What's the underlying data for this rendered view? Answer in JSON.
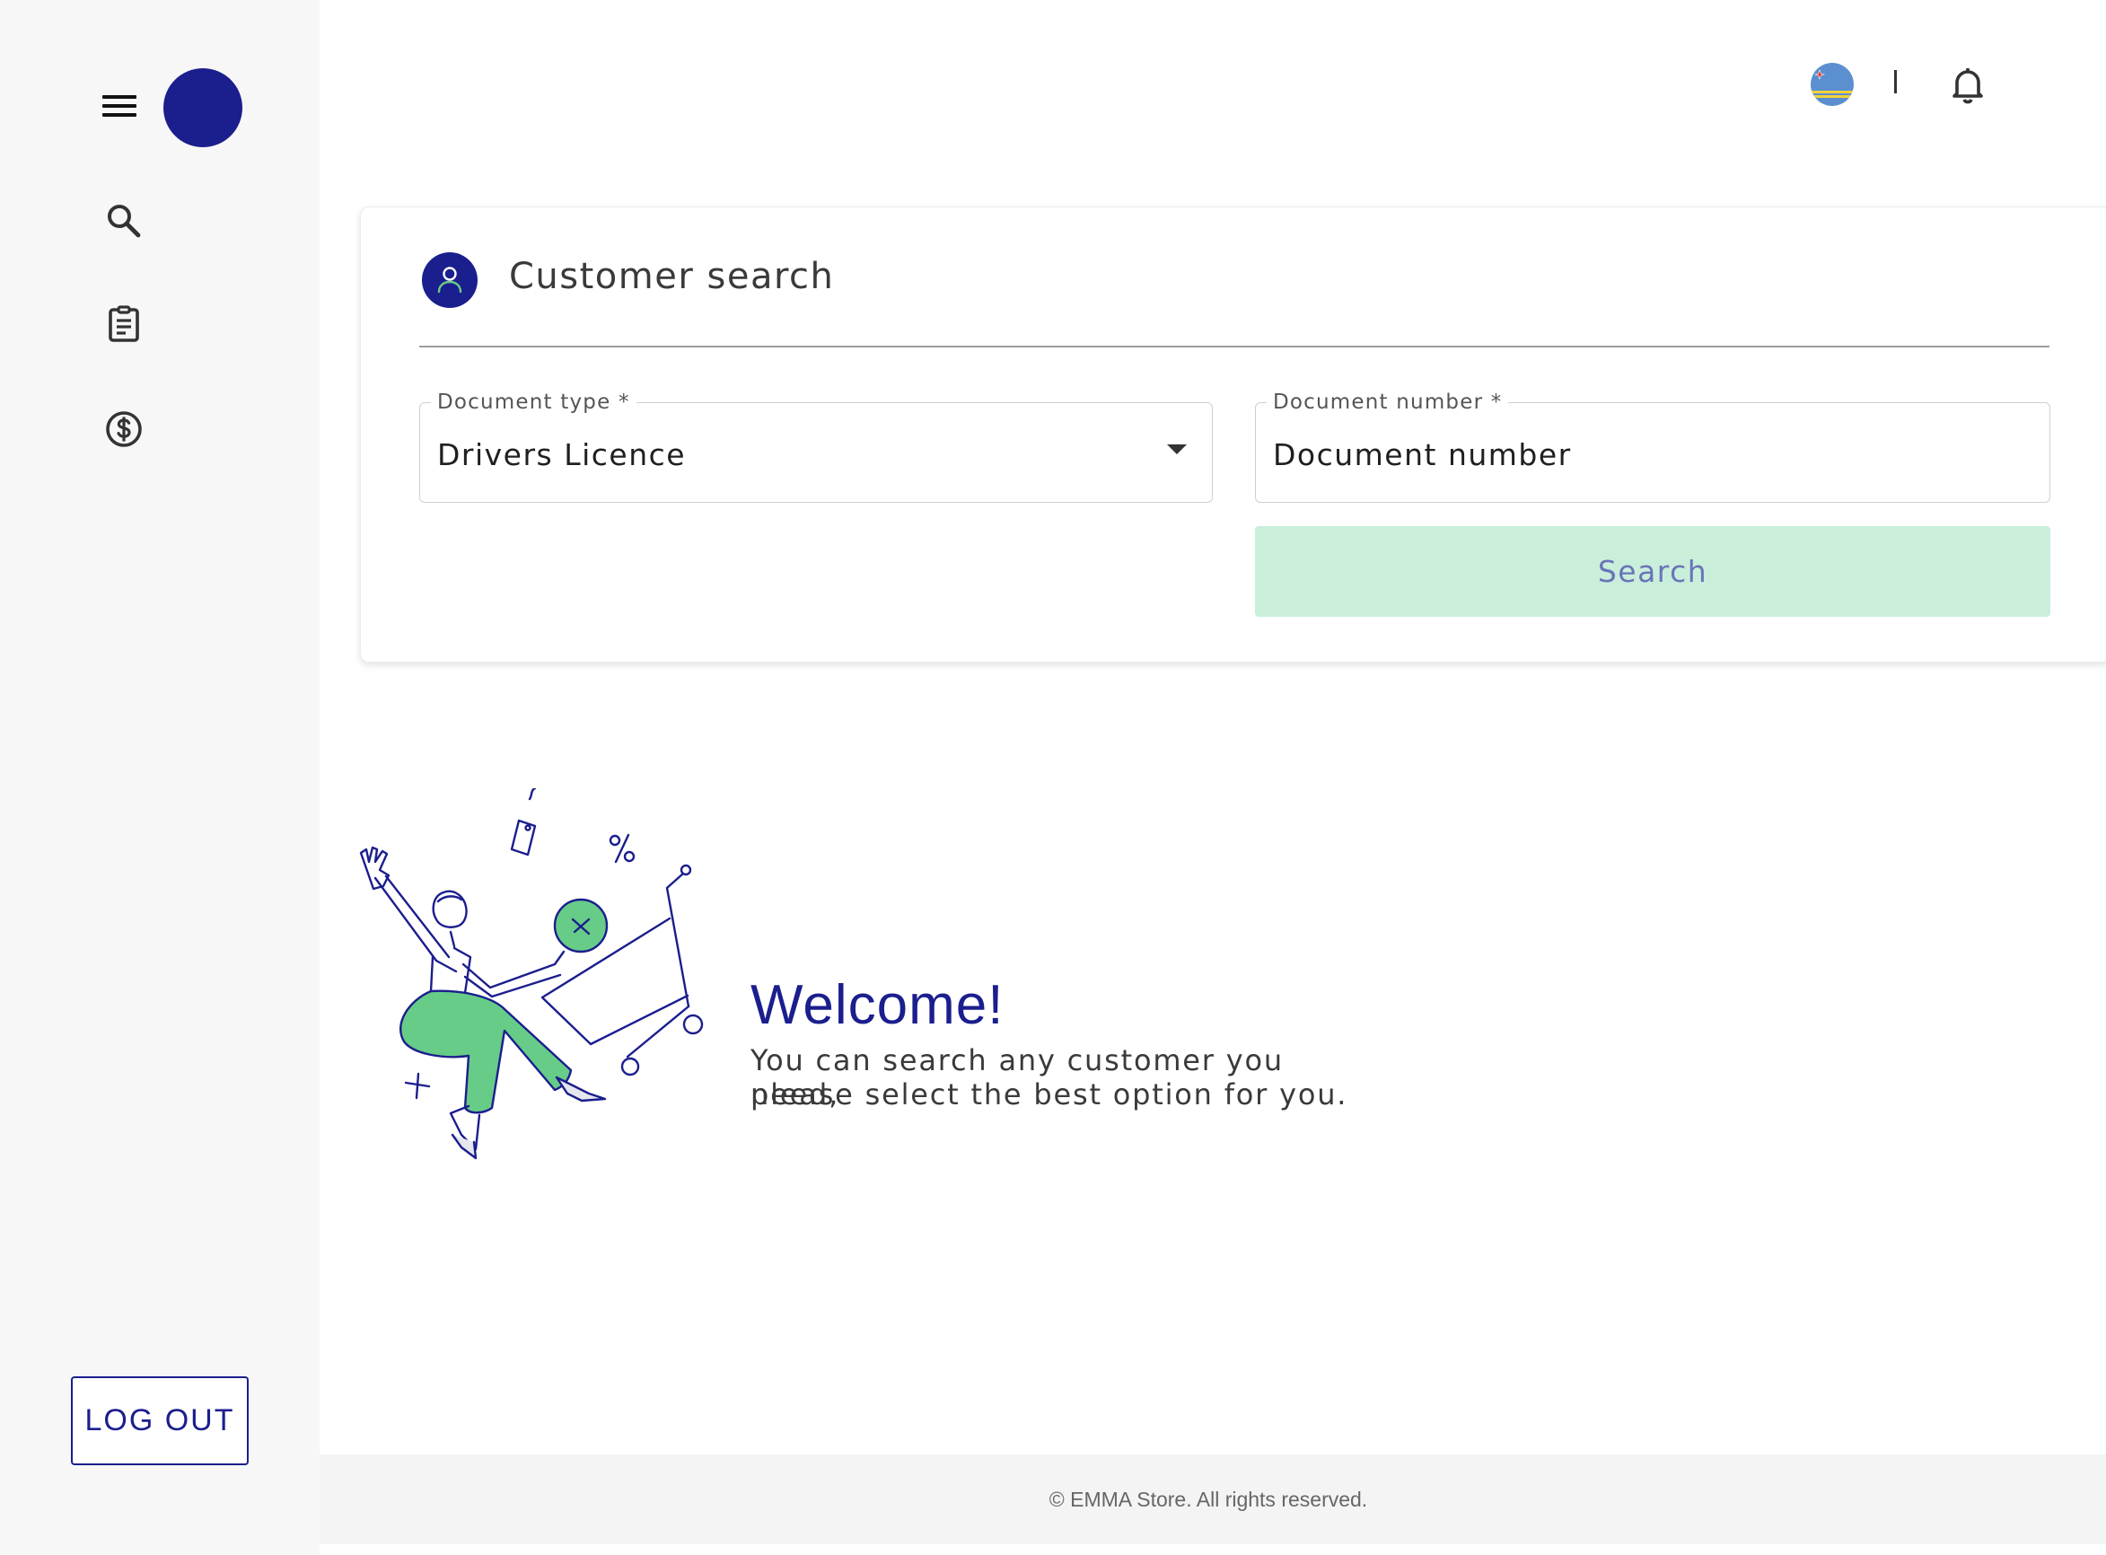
{
  "sidebar": {
    "nav_icons": [
      "search-icon",
      "clipboard-icon",
      "dollar-icon"
    ],
    "logout_label": "LOG OUT"
  },
  "topbar": {
    "separator": "|",
    "flag_icon": "aruba-flag-icon",
    "notification_icon": "bell-icon"
  },
  "customer_search": {
    "title": "Customer search",
    "document_type": {
      "label": "Document type *",
      "value": "Drivers Licence"
    },
    "document_number": {
      "label": "Document number *",
      "placeholder": "Document number"
    },
    "search_label": "Search"
  },
  "welcome": {
    "title": "Welcome!",
    "line1": "You can search any customer you need,",
    "line2": "please select the best option for you."
  },
  "footer": {
    "text": "© EMMA Store. All rights reserved."
  },
  "colors": {
    "brand": "#1b1e8d",
    "accent_green": "#66cc87",
    "button_disabled_bg": "#c9efdb",
    "sidebar_bg": "#f7f7f7",
    "footer_bg": "#f4f4f4"
  }
}
